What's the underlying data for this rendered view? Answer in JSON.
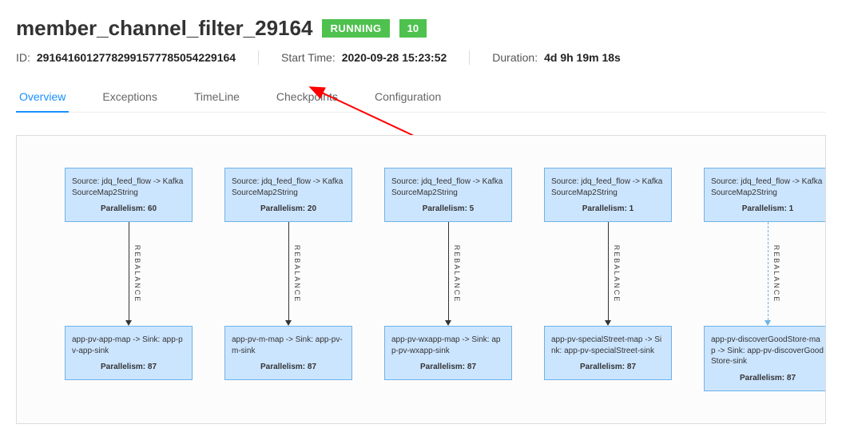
{
  "header": {
    "title": "member_channel_filter_29164",
    "status": "RUNNING",
    "count": "10",
    "id_label": "ID:",
    "id_value": "29164160127782991577785054229164",
    "start_label": "Start Time:",
    "start_value": "2020-09-28 15:23:52",
    "duration_label": "Duration:",
    "duration_value": "4d 9h 19m 18s"
  },
  "tabs": {
    "overview": "Overview",
    "exceptions": "Exceptions",
    "timeline": "TimeLine",
    "checkpoints": "Checkpoints",
    "configuration": "Configuration"
  },
  "graph": {
    "edge_label": "REBALANCE",
    "columns": [
      {
        "source_title": "Source: jdq_feed_flow -> KafkaSourceMap2String",
        "source_parallel": "Parallelism: 60",
        "sink_title": "app-pv-app-map -> Sink: app-pv-app-sink",
        "sink_parallel": "Parallelism: 87",
        "dashed": false
      },
      {
        "source_title": "Source: jdq_feed_flow -> KafkaSourceMap2String",
        "source_parallel": "Parallelism: 20",
        "sink_title": "app-pv-m-map -> Sink: app-pv-m-sink",
        "sink_parallel": "Parallelism: 87",
        "dashed": false
      },
      {
        "source_title": "Source: jdq_feed_flow -> KafkaSourceMap2String",
        "source_parallel": "Parallelism: 5",
        "sink_title": "app-pv-wxapp-map -> Sink: app-pv-wxapp-sink",
        "sink_parallel": "Parallelism: 87",
        "dashed": false
      },
      {
        "source_title": "Source: jdq_feed_flow -> KafkaSourceMap2String",
        "source_parallel": "Parallelism: 1",
        "sink_title": "app-pv-specialStreet-map -> Sink: app-pv-specialStreet-sink",
        "sink_parallel": "Parallelism: 87",
        "dashed": false
      },
      {
        "source_title": "Source: jdq_feed_flow -> KafkaSourceMap2String",
        "source_parallel": "Parallelism: 1",
        "sink_title": "app-pv-discoverGoodStore-map -> Sink: app-pv-discoverGoodStore-sink",
        "sink_parallel": "Parallelism: 87",
        "dashed": true
      }
    ]
  }
}
